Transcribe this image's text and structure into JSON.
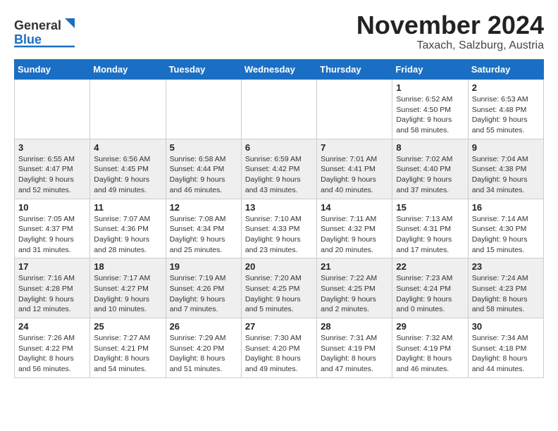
{
  "header": {
    "logo_line1": "General",
    "logo_line2": "Blue",
    "title": "November 2024",
    "location": "Taxach, Salzburg, Austria"
  },
  "weekdays": [
    "Sunday",
    "Monday",
    "Tuesday",
    "Wednesday",
    "Thursday",
    "Friday",
    "Saturday"
  ],
  "weeks": [
    [
      {
        "day": "",
        "info": ""
      },
      {
        "day": "",
        "info": ""
      },
      {
        "day": "",
        "info": ""
      },
      {
        "day": "",
        "info": ""
      },
      {
        "day": "",
        "info": ""
      },
      {
        "day": "1",
        "info": "Sunrise: 6:52 AM\nSunset: 4:50 PM\nDaylight: 9 hours and 58 minutes."
      },
      {
        "day": "2",
        "info": "Sunrise: 6:53 AM\nSunset: 4:48 PM\nDaylight: 9 hours and 55 minutes."
      }
    ],
    [
      {
        "day": "3",
        "info": "Sunrise: 6:55 AM\nSunset: 4:47 PM\nDaylight: 9 hours and 52 minutes."
      },
      {
        "day": "4",
        "info": "Sunrise: 6:56 AM\nSunset: 4:45 PM\nDaylight: 9 hours and 49 minutes."
      },
      {
        "day": "5",
        "info": "Sunrise: 6:58 AM\nSunset: 4:44 PM\nDaylight: 9 hours and 46 minutes."
      },
      {
        "day": "6",
        "info": "Sunrise: 6:59 AM\nSunset: 4:42 PM\nDaylight: 9 hours and 43 minutes."
      },
      {
        "day": "7",
        "info": "Sunrise: 7:01 AM\nSunset: 4:41 PM\nDaylight: 9 hours and 40 minutes."
      },
      {
        "day": "8",
        "info": "Sunrise: 7:02 AM\nSunset: 4:40 PM\nDaylight: 9 hours and 37 minutes."
      },
      {
        "day": "9",
        "info": "Sunrise: 7:04 AM\nSunset: 4:38 PM\nDaylight: 9 hours and 34 minutes."
      }
    ],
    [
      {
        "day": "10",
        "info": "Sunrise: 7:05 AM\nSunset: 4:37 PM\nDaylight: 9 hours and 31 minutes."
      },
      {
        "day": "11",
        "info": "Sunrise: 7:07 AM\nSunset: 4:36 PM\nDaylight: 9 hours and 28 minutes."
      },
      {
        "day": "12",
        "info": "Sunrise: 7:08 AM\nSunset: 4:34 PM\nDaylight: 9 hours and 25 minutes."
      },
      {
        "day": "13",
        "info": "Sunrise: 7:10 AM\nSunset: 4:33 PM\nDaylight: 9 hours and 23 minutes."
      },
      {
        "day": "14",
        "info": "Sunrise: 7:11 AM\nSunset: 4:32 PM\nDaylight: 9 hours and 20 minutes."
      },
      {
        "day": "15",
        "info": "Sunrise: 7:13 AM\nSunset: 4:31 PM\nDaylight: 9 hours and 17 minutes."
      },
      {
        "day": "16",
        "info": "Sunrise: 7:14 AM\nSunset: 4:30 PM\nDaylight: 9 hours and 15 minutes."
      }
    ],
    [
      {
        "day": "17",
        "info": "Sunrise: 7:16 AM\nSunset: 4:28 PM\nDaylight: 9 hours and 12 minutes."
      },
      {
        "day": "18",
        "info": "Sunrise: 7:17 AM\nSunset: 4:27 PM\nDaylight: 9 hours and 10 minutes."
      },
      {
        "day": "19",
        "info": "Sunrise: 7:19 AM\nSunset: 4:26 PM\nDaylight: 9 hours and 7 minutes."
      },
      {
        "day": "20",
        "info": "Sunrise: 7:20 AM\nSunset: 4:25 PM\nDaylight: 9 hours and 5 minutes."
      },
      {
        "day": "21",
        "info": "Sunrise: 7:22 AM\nSunset: 4:25 PM\nDaylight: 9 hours and 2 minutes."
      },
      {
        "day": "22",
        "info": "Sunrise: 7:23 AM\nSunset: 4:24 PM\nDaylight: 9 hours and 0 minutes."
      },
      {
        "day": "23",
        "info": "Sunrise: 7:24 AM\nSunset: 4:23 PM\nDaylight: 8 hours and 58 minutes."
      }
    ],
    [
      {
        "day": "24",
        "info": "Sunrise: 7:26 AM\nSunset: 4:22 PM\nDaylight: 8 hours and 56 minutes."
      },
      {
        "day": "25",
        "info": "Sunrise: 7:27 AM\nSunset: 4:21 PM\nDaylight: 8 hours and 54 minutes."
      },
      {
        "day": "26",
        "info": "Sunrise: 7:29 AM\nSunset: 4:20 PM\nDaylight: 8 hours and 51 minutes."
      },
      {
        "day": "27",
        "info": "Sunrise: 7:30 AM\nSunset: 4:20 PM\nDaylight: 8 hours and 49 minutes."
      },
      {
        "day": "28",
        "info": "Sunrise: 7:31 AM\nSunset: 4:19 PM\nDaylight: 8 hours and 47 minutes."
      },
      {
        "day": "29",
        "info": "Sunrise: 7:32 AM\nSunset: 4:19 PM\nDaylight: 8 hours and 46 minutes."
      },
      {
        "day": "30",
        "info": "Sunrise: 7:34 AM\nSunset: 4:18 PM\nDaylight: 8 hours and 44 minutes."
      }
    ]
  ]
}
